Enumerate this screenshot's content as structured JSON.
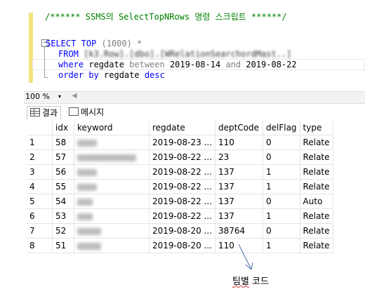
{
  "editor": {
    "comment": "/****** SSMS의 SelectTopNRows 명령 스크립트 ******/",
    "line_select_kw": "SELECT",
    "line_top_kw": "TOP",
    "line_top_value": " (1000) *",
    "line_from_kw": "FROM",
    "line_from_obj": " [k3.Row].[dbo].[WRelationSearchordMast..]",
    "line_where_kw": "where",
    "line_where_col": " regdate ",
    "line_between_kw": "between",
    "line_date1": " 2019-08-14 ",
    "line_and_kw": "and",
    "line_date2": " 2019-08-22",
    "line_order_kw": "order by",
    "line_order_col": " regdate ",
    "line_desc_kw": "desc",
    "fold_symbol": "−"
  },
  "zoom": {
    "value": "100 %",
    "dropdown_symbol": "▾",
    "scroll_arrow": "◀"
  },
  "tabs": {
    "results": "결과",
    "messages": "메시지"
  },
  "grid": {
    "columns": [
      "",
      "idx",
      "keyword",
      "regdate",
      "deptCode",
      "delFlag",
      "type"
    ],
    "rows": [
      {
        "n": "1",
        "idx": "58",
        "regdate": "2019-08-23 ...",
        "dept": "110",
        "del": "0",
        "type": "Relate",
        "kw_w": 28
      },
      {
        "n": "2",
        "idx": "57",
        "regdate": "2019-08-22 ...",
        "dept": "23",
        "del": "0",
        "type": "Relate",
        "kw_w": 84
      },
      {
        "n": "3",
        "idx": "56",
        "regdate": "2019-08-22 ...",
        "dept": "137",
        "del": "1",
        "type": "Relate",
        "kw_w": 28
      },
      {
        "n": "4",
        "idx": "55",
        "regdate": "2019-08-22 ...",
        "dept": "137",
        "del": "1",
        "type": "Relate",
        "kw_w": 28
      },
      {
        "n": "5",
        "idx": "54",
        "regdate": "2019-08-22 ...",
        "dept": "137",
        "del": "0",
        "type": "Auto",
        "kw_w": 22
      },
      {
        "n": "6",
        "idx": "53",
        "regdate": "2019-08-22 ...",
        "dept": "137",
        "del": "1",
        "type": "Relate",
        "kw_w": 22
      },
      {
        "n": "7",
        "idx": "52",
        "regdate": "2019-08-20 ...",
        "dept": "38764",
        "del": "0",
        "type": "Relate",
        "kw_w": 34
      },
      {
        "n": "8",
        "idx": "51",
        "regdate": "2019-08-20 ...",
        "dept": "110",
        "del": "1",
        "type": "Relate",
        "kw_w": 34
      }
    ]
  },
  "annotation": {
    "part1": "팀별",
    "part2": " 코드"
  }
}
